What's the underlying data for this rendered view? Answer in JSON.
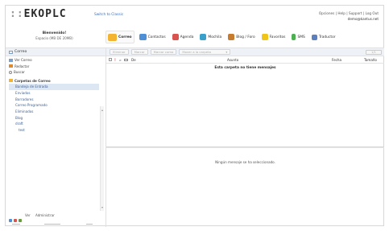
{
  "header": {
    "logo": "EKOPLC",
    "switch_link": "Switch to Classic",
    "links": "Opciones | Help | Support | Log Out",
    "email": "demo@kantus.net"
  },
  "welcome": {
    "line1": "Bienvenido!",
    "line2": "Espacio (MB DE 20MB)"
  },
  "toolbar": {
    "items": [
      {
        "label": "Correo",
        "icon": "envelope-icon",
        "color": "#f2b431"
      },
      {
        "label": "Contactos",
        "icon": "contacts-icon",
        "color": "#4f8fd6"
      },
      {
        "label": "Agenda",
        "icon": "calendar-icon",
        "color": "#d9534f"
      },
      {
        "label": "Mochila",
        "icon": "backpack-icon",
        "color": "#3aa0c9"
      },
      {
        "label": "Blog / Foro",
        "icon": "blog-icon",
        "color": "#c77b2e"
      },
      {
        "label": "Favoritos",
        "icon": "star-icon",
        "color": "#f0c419"
      },
      {
        "label": "SMS",
        "icon": "phone-icon",
        "color": "#4caf50"
      },
      {
        "label": "Traductor",
        "icon": "translate-icon",
        "color": "#5b7fbf"
      }
    ]
  },
  "sidebar": {
    "title": "Correo",
    "actions": [
      {
        "label": "Ver Correo",
        "icon": "inbox-icon",
        "color": "#7aa0cf"
      },
      {
        "label": "Redactar",
        "icon": "pencil-icon",
        "color": "#e08a2e"
      },
      {
        "label": "Buscar",
        "icon": "search-icon",
        "color": "#888888"
      }
    ],
    "section": "Carpetas de Correo",
    "folders": [
      "Bandeja de Entrada",
      "Enviados",
      "Borradores",
      "Correo Programado",
      "Eliminados",
      "Blog",
      "draft",
      "test"
    ],
    "footer_links": "Ver Administrar"
  },
  "subtoolbar": {
    "buttons": [
      "Eliminar",
      "Marcar",
      "Marcar como"
    ],
    "move_select": "Mover a la carpeta",
    "pager": "1/1"
  },
  "columns": {
    "from": "De",
    "subject": "Asunto",
    "date": "Fecha",
    "size": "Tamaño"
  },
  "messages": {
    "empty_folder": "Esta carpeta no tiene mensajes",
    "none_selected": "Ningún mensaje se ha seleccionado."
  }
}
